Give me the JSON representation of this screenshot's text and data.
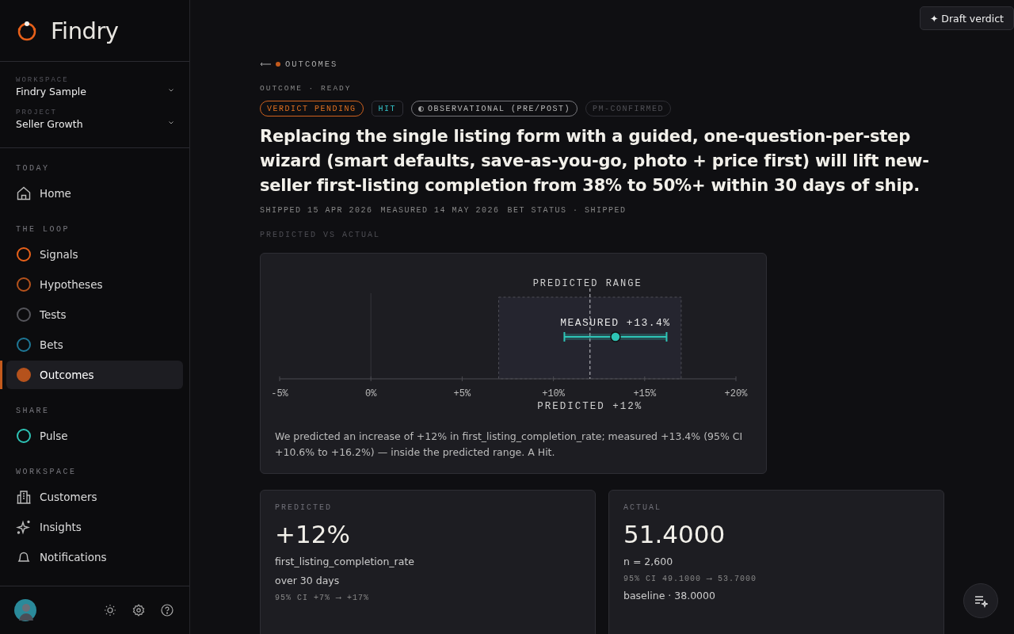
{
  "brand": {
    "name": "Findry"
  },
  "workspace": {
    "label": "WORKSPACE",
    "value": "Findry Sample"
  },
  "project": {
    "label": "PROJECT",
    "value": "Seller Growth"
  },
  "nav_sections": [
    {
      "title": "TODAY",
      "items": [
        {
          "label": "Home",
          "kind": "home",
          "selected": false
        }
      ]
    },
    {
      "title": "THE LOOP",
      "items": [
        {
          "label": "Signals",
          "kind": "dot",
          "color": "#e8611a",
          "selected": false
        },
        {
          "label": "Hypotheses",
          "kind": "dot",
          "color": "#b5521c",
          "selected": false
        },
        {
          "label": "Tests",
          "kind": "dot",
          "color": "#55555b",
          "selected": false
        },
        {
          "label": "Bets",
          "kind": "dot",
          "color": "#1e7796",
          "selected": false
        },
        {
          "label": "Outcomes",
          "kind": "dot",
          "color": "#b5521c",
          "selected": true
        }
      ]
    },
    {
      "title": "SHARE",
      "items": [
        {
          "label": "Pulse",
          "kind": "dot",
          "color": "#2ec4b6",
          "selected": false
        }
      ]
    },
    {
      "title": "WORKSPACE",
      "items": [
        {
          "label": "Customers",
          "kind": "building",
          "selected": false
        },
        {
          "label": "Insights",
          "kind": "sparkle",
          "selected": false
        },
        {
          "label": "Notifications",
          "kind": "bell",
          "selected": false
        }
      ]
    }
  ],
  "draft_button": {
    "icon": "✦",
    "label": "Draft verdict"
  },
  "breadcrumb": {
    "label": "OUTCOMES"
  },
  "status_line": "OUTCOME · READY",
  "tags": [
    {
      "label": "VERDICT PENDING",
      "kind": "verdict"
    },
    {
      "label": "HIT",
      "kind": "result"
    },
    {
      "label": "OBSERVATIONAL (PRE/POST)",
      "kind": "method"
    },
    {
      "label": "PM-CONFIRMED",
      "kind": "muted"
    }
  ],
  "title": "Replacing the single listing form with a guided, one-question-per-step wizard (smart defaults, save-as-you-go, photo + price first) will lift new-seller first-listing completion from 38% to 50%+ within 30 days of ship.",
  "meta": [
    "SHIPPED 15 APR 2026",
    "MEASURED 14 MAY 2026",
    "BET STATUS · SHIPPED"
  ],
  "section_label": "PREDICTED VS ACTUAL",
  "chart": {
    "chart_data": {
      "type": "scatter",
      "xlim": [
        -5,
        20
      ],
      "xticks": [
        {
          "value": -5,
          "label": "-5%"
        },
        {
          "value": 0,
          "label": "0%"
        },
        {
          "value": 5,
          "label": "+5%"
        },
        {
          "value": 10,
          "label": "+10%"
        },
        {
          "value": 15,
          "label": "+15%"
        },
        {
          "value": 20,
          "label": "+20%"
        }
      ],
      "orientation": "horizontal",
      "categories": [
        null
      ],
      "series": [
        {
          "name": "MEASURED +13.4%",
          "color": "#2ec4b6",
          "values": [
            13.4
          ]
        }
      ],
      "bands": [
        {
          "axis": "x",
          "from": 7,
          "to": 17,
          "label": "PREDICTED RANGE"
        },
        {
          "axis": "x",
          "from": 10.6,
          "to": 16.2
        }
      ],
      "ref_lines": [
        {
          "axis": "x",
          "value": 12,
          "label": "PREDICTED +12%"
        }
      ]
    },
    "summary": "We predicted an increase of +12% in first_listing_completion_rate; measured +13.4% (95% CI +10.6% to +16.2%) — inside the predicted range. A Hit."
  },
  "cards": [
    {
      "label": "PREDICTED",
      "value": "+12%",
      "lines": [
        "first_listing_completion_rate",
        "over 30 days"
      ],
      "ci": "95% CI +7% ⟶ +17%"
    },
    {
      "label": "ACTUAL",
      "value": "51.4000",
      "lines": [
        "n = 2,600"
      ],
      "ci": "95% CI 49.1000 ⟶ 53.7000",
      "foot": "baseline · 38.0000"
    }
  ]
}
